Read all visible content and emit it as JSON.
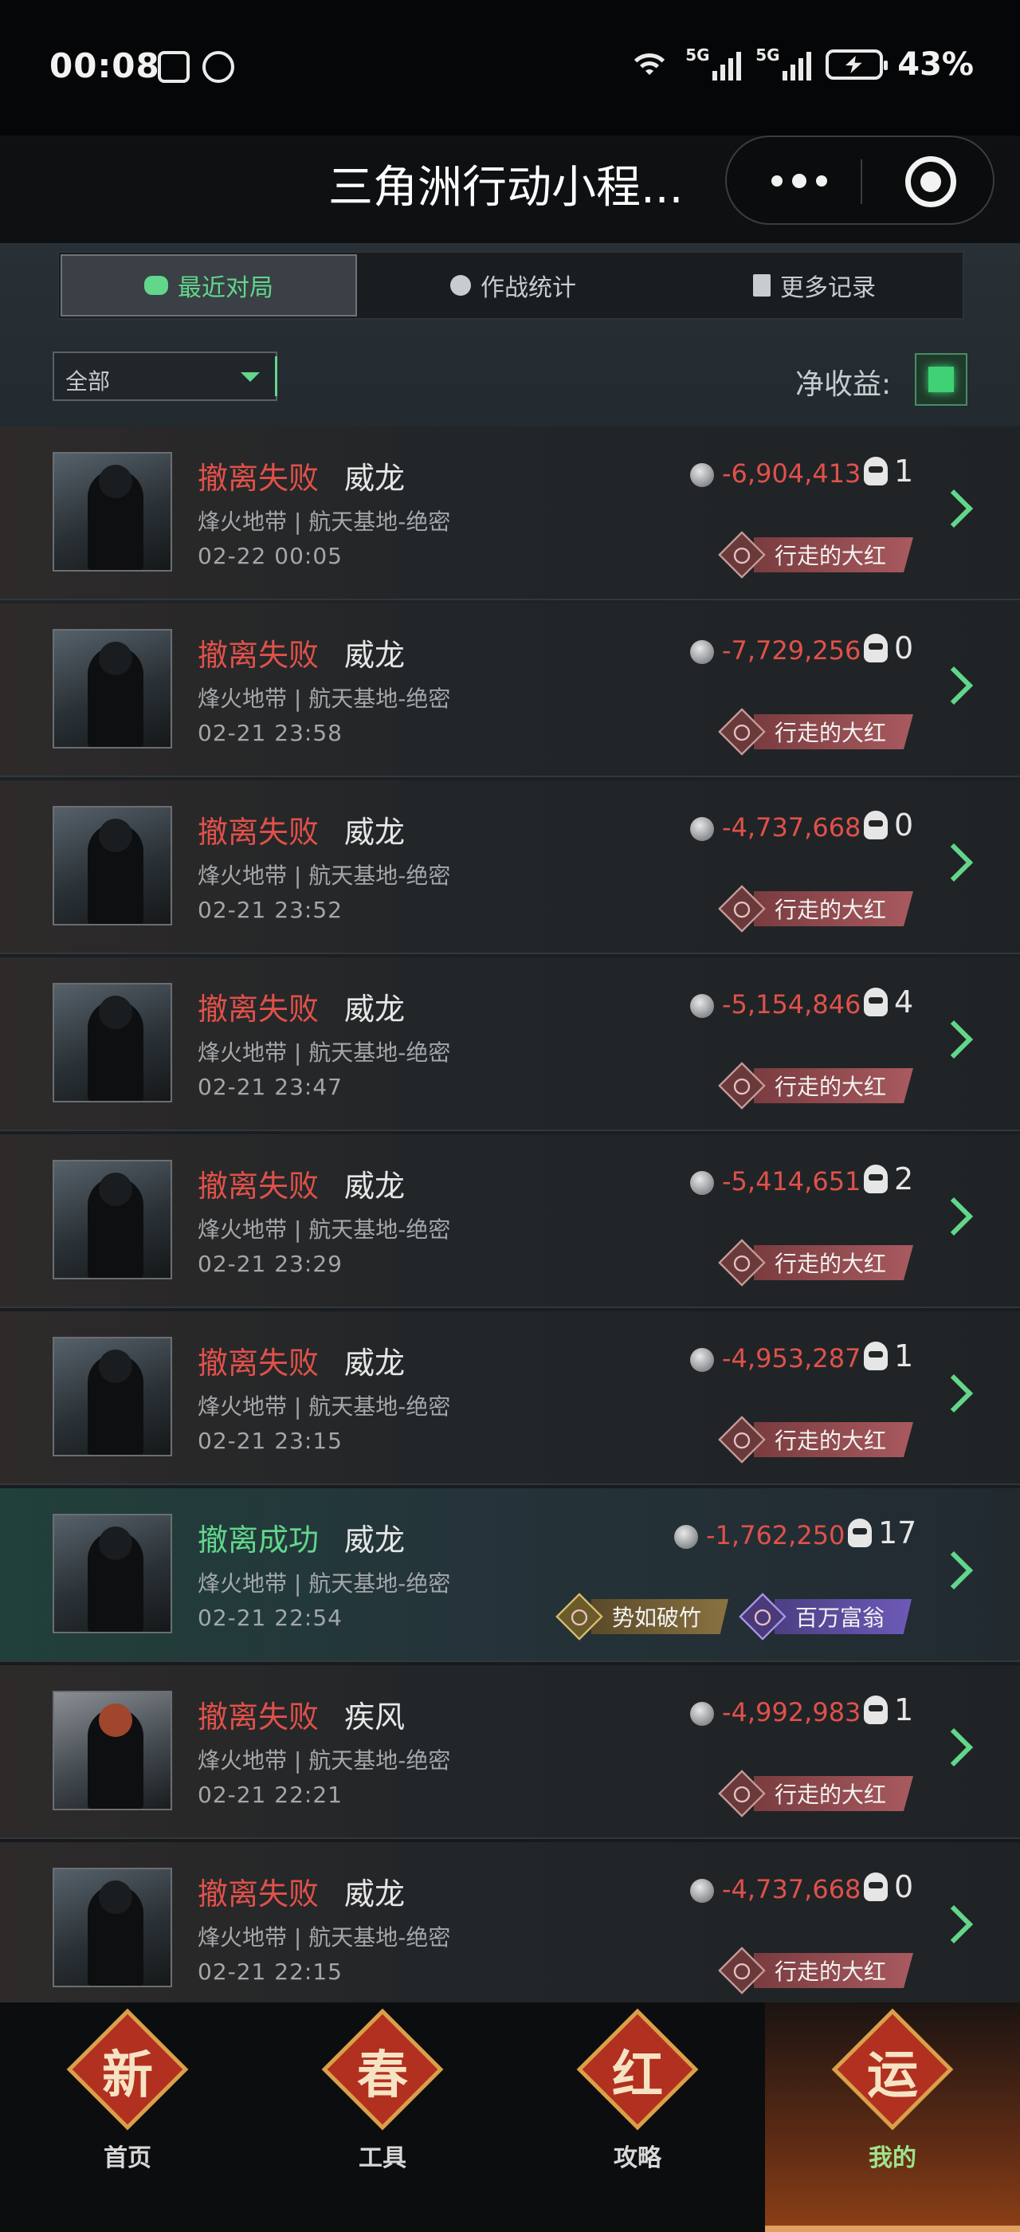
{
  "statusbar": {
    "time": "00:08",
    "network_1": "5G",
    "network_2": "5G",
    "battery": "43%"
  },
  "titlebar": {
    "title": "三角洲行动小程..."
  },
  "tabs": [
    {
      "label": "最近对局",
      "icon": "gamepad-icon",
      "active": true
    },
    {
      "label": "作战统计",
      "icon": "pie-chart-icon",
      "active": false
    },
    {
      "label": "更多记录",
      "icon": "document-icon",
      "active": false
    }
  ],
  "filter": {
    "selected": "全部",
    "net_profit_label": "净收益:"
  },
  "matches": [
    {
      "status": "撤离失败",
      "operator": "威龙",
      "map": "烽火地带 | 航天基地-绝密",
      "time": "02-22 00:05",
      "profit": "-6,904,413",
      "kills": "1",
      "badges": [
        "行走的大红"
      ]
    },
    {
      "status": "撤离失败",
      "operator": "威龙",
      "map": "烽火地带 | 航天基地-绝密",
      "time": "02-21 23:58",
      "profit": "-7,729,256",
      "kills": "0",
      "badges": [
        "行走的大红"
      ]
    },
    {
      "status": "撤离失败",
      "operator": "威龙",
      "map": "烽火地带 | 航天基地-绝密",
      "time": "02-21 23:52",
      "profit": "-4,737,668",
      "kills": "0",
      "badges": [
        "行走的大红"
      ]
    },
    {
      "status": "撤离失败",
      "operator": "威龙",
      "map": "烽火地带 | 航天基地-绝密",
      "time": "02-21 23:47",
      "profit": "-5,154,846",
      "kills": "4",
      "badges": [
        "行走的大红"
      ]
    },
    {
      "status": "撤离失败",
      "operator": "威龙",
      "map": "烽火地带 | 航天基地-绝密",
      "time": "02-21 23:29",
      "profit": "-5,414,651",
      "kills": "2",
      "badges": [
        "行走的大红"
      ]
    },
    {
      "status": "撤离失败",
      "operator": "威龙",
      "map": "烽火地带 | 航天基地-绝密",
      "time": "02-21 23:15",
      "profit": "-4,953,287",
      "kills": "1",
      "badges": [
        "行走的大红"
      ]
    },
    {
      "status": "撤离成功",
      "operator": "威龙",
      "map": "烽火地带 | 航天基地-绝密",
      "time": "02-21 22:54",
      "profit": "-1,762,250",
      "kills": "17",
      "badges": [
        "势如破竹",
        "百万富翁"
      ]
    },
    {
      "status": "撤离失败",
      "operator": "疾风",
      "map": "烽火地带 | 航天基地-绝密",
      "time": "02-21 22:21",
      "profit": "-4,992,983",
      "kills": "1",
      "badges": [
        "行走的大红"
      ]
    },
    {
      "status": "撤离失败",
      "operator": "威龙",
      "map": "烽火地带 | 航天基地-绝密",
      "time": "02-21 22:15",
      "profit": "-4,737,668",
      "kills": "0",
      "badges": [
        "行走的大红"
      ]
    }
  ],
  "bottomnav": [
    {
      "emblem": "新",
      "label": "首页",
      "active": false
    },
    {
      "emblem": "春",
      "label": "工具",
      "active": false
    },
    {
      "emblem": "红",
      "label": "攻略",
      "active": false
    },
    {
      "emblem": "运",
      "label": "我的",
      "active": true
    }
  ],
  "colors": {
    "accent_green": "#62d68b",
    "fail_red": "#e0514a"
  }
}
